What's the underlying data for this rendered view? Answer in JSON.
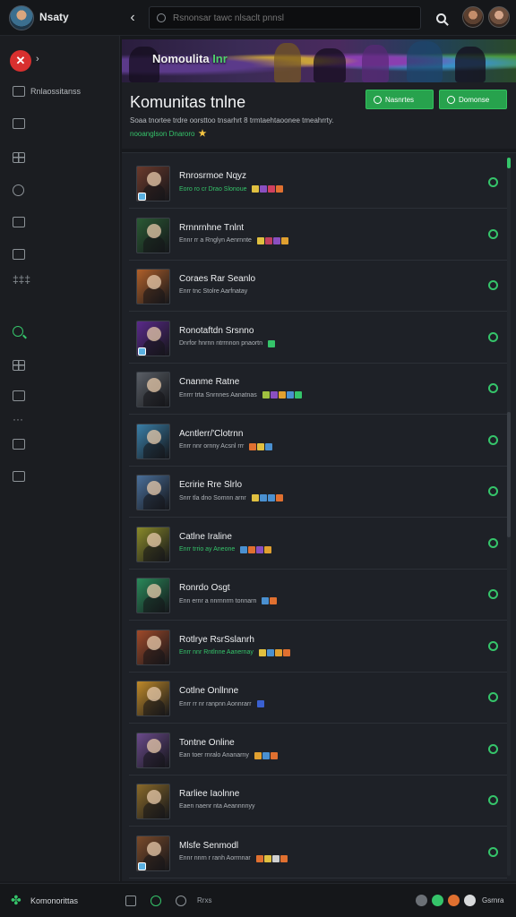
{
  "app": {
    "name": "Nsaty"
  },
  "search": {
    "placeholder": "Rsnonsar tawc nlsaclt pnnsl"
  },
  "brand": {
    "chevron": "›"
  },
  "sidebar": {
    "items": [
      {
        "label": "Rnlaossitanss",
        "icon": "list-icon"
      },
      {
        "label": "",
        "icon": "people-icon"
      },
      {
        "label": "",
        "icon": "grid-icon"
      },
      {
        "label": "",
        "icon": "clock-icon"
      },
      {
        "label": "",
        "icon": "page-icon"
      },
      {
        "label": "",
        "icon": "image-icon"
      },
      {
        "label": "‡‡‡",
        "icon": "glyph-icon"
      },
      {
        "label": "",
        "icon": "search-icon"
      },
      {
        "label": "",
        "icon": "controller-icon"
      },
      {
        "label": "",
        "icon": "puzzle-icon"
      },
      {
        "label": "···",
        "icon": "dots-icon"
      },
      {
        "label": "",
        "icon": "wrench-icon"
      },
      {
        "label": "",
        "icon": "bag-icon"
      }
    ]
  },
  "banner": {
    "title": "Nomoulita",
    "title_accent": "Inr"
  },
  "community": {
    "title": "Komunitas tnlne",
    "description": "Soaa tnortee trdre oorsttoo tnsarhrt 8 trmtaehtaoonee tmeahrrty.",
    "subtitle": "nooanglson Dnaroro",
    "subtitle_star": "★",
    "join_label": "Nasnrtes",
    "create_label": "Domonse"
  },
  "members": [
    {
      "name": "Rnrosrmoe Nqyz",
      "status": "Eoro ro cr Drao Slonoue",
      "status_green": true,
      "avatar": "#6b3a2c",
      "games": [
        "#e0c040",
        "#8a4fc0",
        "#d04060",
        "#e07030"
      ]
    },
    {
      "name": "Rrnnrnhne Tnlnt",
      "status": "Ennr rr a Rnglyn Aenrnnte",
      "status_green": false,
      "avatar": "#2a5a34",
      "games": [
        "#e0c040",
        "#c04060",
        "#8a4fc0",
        "#e0a030"
      ]
    },
    {
      "name": "Coraes Rar Seanlo",
      "status": "Enrr tnc Stolre Aarfnatay",
      "status_green": false,
      "avatar": "#b0602a",
      "games": []
    },
    {
      "name": "Ronotaftdn Srsnno",
      "status": "Dnrfor hnrnn ntrrnnon pnaortn",
      "status_green": false,
      "avatar": "#5a2a8a",
      "games": [
        "#35c46a"
      ]
    },
    {
      "name": "Cnanme Ratne",
      "status": "Enrrr trta Snrnnes Aanatnas",
      "status_green": false,
      "avatar": "#5a5f66",
      "games": [
        "#a0c040",
        "#8a4fc0",
        "#e0a030",
        "#4a90d0",
        "#35c46a"
      ]
    },
    {
      "name": "Acntlerr/'Clotrnn",
      "status": "Enrr nnr ornny Acsnl rrr",
      "status_green": false,
      "avatar": "#3a7fa8",
      "games": [
        "#e07030",
        "#e0c040",
        "#4a90d0"
      ]
    },
    {
      "name": "Ecririe Rre Slrlo",
      "status": "Snrr tla dno Somnn arnr",
      "status_green": false,
      "avatar": "#4a6f9a",
      "games": [
        "#e0c040",
        "#4a90d0",
        "#4a90d0",
        "#e07030"
      ]
    },
    {
      "name": "Catlne Iraline",
      "status": "Enrr trrio ay Aneone",
      "status_green": true,
      "avatar": "#8a8a2a",
      "games": [
        "#4a90d0",
        "#e07030",
        "#8a4fc0",
        "#e0a030"
      ]
    },
    {
      "name": "Ronrdo Osgt",
      "status": "Enn ernr a nnrnnrm tonnarn",
      "status_green": false,
      "avatar": "#2a8a5a",
      "games": [
        "#4a90d0",
        "#e07030"
      ]
    },
    {
      "name": "Rotlrye RsrSslanrh",
      "status": "Enrr nnr Rntlnne Aanernay",
      "status_green": true,
      "avatar": "#a04a2a",
      "games": [
        "#e0c040",
        "#4a90d0",
        "#e0a030",
        "#e07030"
      ]
    },
    {
      "name": "Cotlne Onllnne",
      "status": "Enrr rr nr ranpnn Aonnrarr",
      "status_green": false,
      "avatar": "#c08a2a",
      "games": [
        "#3a60d0"
      ]
    },
    {
      "name": "Tontne Online",
      "status": "Ean toer rnralo Ananarny",
      "status_green": false,
      "avatar": "#6a4a8a",
      "games": [
        "#e0a030",
        "#4a90d0",
        "#e07030"
      ]
    },
    {
      "name": "Rarliee Iaolnne",
      "status": "Eaen naenr nta Aeannnnyy",
      "status_green": false,
      "avatar": "#8a6a2a",
      "games": []
    },
    {
      "name": "Mlsfe Senmodl",
      "status": "Ennr nnrn r ranh Aorrnnar",
      "status_green": false,
      "avatar": "#7a4a2a",
      "games": [
        "#e07030",
        "#e0c040",
        "#d0d0d0",
        "#e07030"
      ]
    }
  ],
  "bottombar": {
    "label": "Komonorittas",
    "text": "Rrxs",
    "right_label": "Gsrnra",
    "dots": [
      "#6b7076",
      "#35c46a",
      "#e07030",
      "#d8dadc"
    ]
  }
}
